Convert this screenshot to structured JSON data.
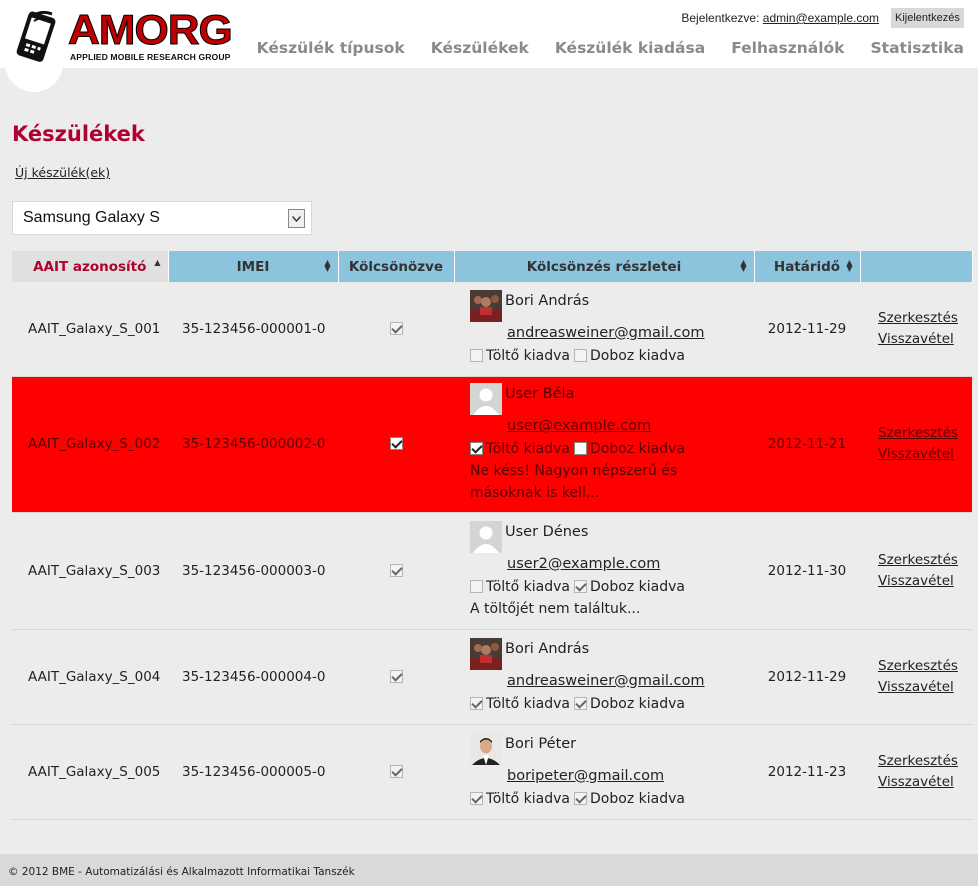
{
  "logo": {
    "text": "AMORG",
    "subtitle": "APPLIED MOBILE RESEARCH GROUP"
  },
  "login": {
    "prefix": "Bejelentkezve: ",
    "user": "admin@example.com",
    "logout": "Kijelentkezés"
  },
  "nav": [
    "Készülék típusok",
    "Készülékek",
    "Készülék kiadása",
    "Felhasználók",
    "Statisztika"
  ],
  "page": {
    "title": "Készülékek",
    "new_link": "Új készülék(ek)",
    "device_select": "Samsung Galaxy S"
  },
  "columns": [
    "AAIT azonosító",
    "IMEI",
    "Kölcsönözve",
    "Kölcsönzés részletei",
    "Határidő"
  ],
  "flag_labels": {
    "charger": "Töltő kiadva",
    "box": "Doboz kiadva"
  },
  "actions": {
    "edit": "Szerkesztés",
    "return": "Visszavétel"
  },
  "rows": [
    {
      "id": "AAIT_Galaxy_S_001",
      "imei": "35-123456-000001-0",
      "loaned": true,
      "name": "Bori András",
      "email": "andreasweiner@gmail.com",
      "avatar": "photo-icon",
      "charger": false,
      "box": false,
      "note": "",
      "due": "2012-11-29",
      "overdue": false
    },
    {
      "id": "AAIT_Galaxy_S_002",
      "imei": "35-123456-000002-0",
      "loaned": true,
      "name": "User Béla",
      "email": "user@example.com",
      "avatar": "default-avatar-icon",
      "charger": true,
      "box": false,
      "note": "Ne késs! Nagyon népszerű és másoknak is kell...",
      "due": "2012-11-21",
      "overdue": true
    },
    {
      "id": "AAIT_Galaxy_S_003",
      "imei": "35-123456-000003-0",
      "loaned": true,
      "name": "User Dénes",
      "email": "user2@example.com",
      "avatar": "default-avatar-icon",
      "charger": false,
      "box": true,
      "note": "A töltőjét nem találtuk...",
      "due": "2012-11-30",
      "overdue": false
    },
    {
      "id": "AAIT_Galaxy_S_004",
      "imei": "35-123456-000004-0",
      "loaned": true,
      "name": "Bori András",
      "email": "andreasweiner@gmail.com",
      "avatar": "photo-icon",
      "charger": true,
      "box": true,
      "note": "",
      "due": "2012-11-29",
      "overdue": false
    },
    {
      "id": "AAIT_Galaxy_S_005",
      "imei": "35-123456-000005-0",
      "loaned": true,
      "name": "Bori Péter",
      "email": "boripeter@gmail.com",
      "avatar": "portrait-icon",
      "charger": true,
      "box": true,
      "note": "",
      "due": "2012-11-23",
      "overdue": false
    }
  ],
  "footer": "© 2012 BME - Automatizálási és Alkalmazott Informatikai Tanszék",
  "colors": {
    "accent": "#b00030",
    "header_blue": "#8cc4dd",
    "overdue_row": "#ff0000",
    "nav_text": "#8a8a8a"
  }
}
